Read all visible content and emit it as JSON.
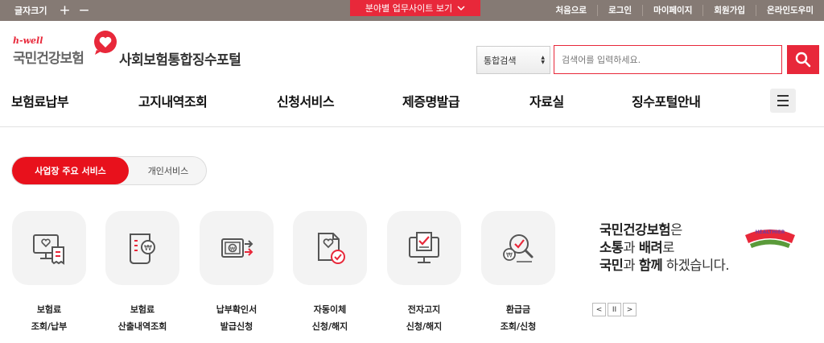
{
  "topbar": {
    "font_size_label": "글자크기",
    "font_plus": "+",
    "font_minus": "−",
    "site_button": "분야별 업무사이트 보기",
    "util_links": [
      "처음으로",
      "로그인",
      "마이페이지",
      "회원가입",
      "온라인도우미"
    ],
    "bg_color": "#857a74",
    "accent_color": "#e8283a"
  },
  "header": {
    "logo_tagline": "h-well",
    "logo_org": "국민건강보험",
    "portal_title": "사회보험통합징수포털",
    "search_scope": "통합검색",
    "search_placeholder": "검색어를 입력하세요."
  },
  "gnb": {
    "items": [
      "보험료납부",
      "고지내역조회",
      "신청서비스",
      "제증명발급",
      "자료실",
      "징수포털안내"
    ]
  },
  "tabs": {
    "active": "사업장 주요 서비스",
    "other": "개인서비스"
  },
  "services": [
    {
      "line1": "보험료",
      "line2": "조회/납부",
      "icon": "monitor-receipt-icon"
    },
    {
      "line1": "보험료",
      "line2": "산출내역조회",
      "icon": "document-coin-icon"
    },
    {
      "line1": "납부확인서",
      "line2": "발급신청",
      "icon": "card-arrow-icon"
    },
    {
      "line1": "자동이체",
      "line2": "신청/해지",
      "icon": "heart-document-check-icon"
    },
    {
      "line1": "전자고지",
      "line2": "신청/해지",
      "icon": "monitor-check-icon"
    },
    {
      "line1": "환급금",
      "line2": "조회/신청",
      "icon": "magnifier-check-icon"
    }
  ],
  "banner": {
    "l1_bold": "국민건강보험",
    "l1_rest": "은",
    "l2_b1": "소통",
    "l2_m": "과 ",
    "l2_b2": "배려",
    "l2_rest": "로",
    "l3_b1": "국민",
    "l3_m": "과 ",
    "l3_b2": "함께",
    "l3_rest": " 하겠습니다.",
    "healthier": "HEALTHIER"
  },
  "controls": {
    "prev": "<",
    "pause": "II",
    "next": ">"
  }
}
